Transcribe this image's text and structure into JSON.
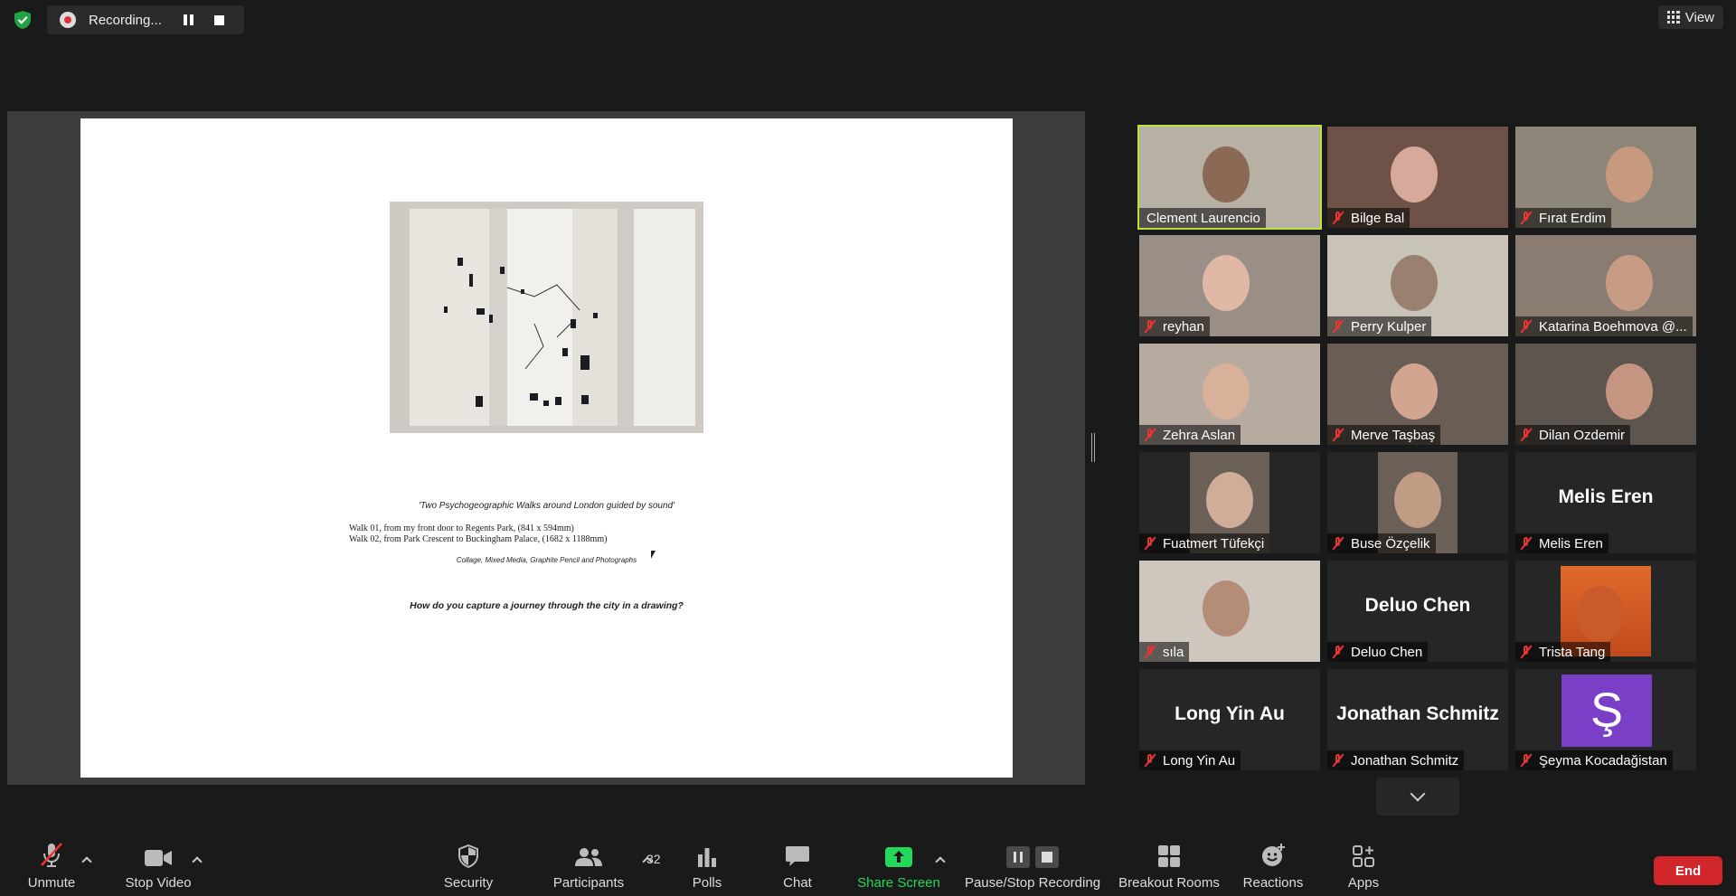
{
  "top_bar": {
    "recording_label": "Recording...",
    "view_label": "View"
  },
  "shared_slide": {
    "caption": "'Two Psychogeographic Walks around London guided by sound'",
    "walk_1": "Walk 01, from my front door to Regents Park, (841 x 594mm)",
    "walk_2": "Walk 02, from Park Crescent to Buckingham Palace, (1682 x 1188mm)",
    "medium": "Collage, Mixed Media, Graphite Pencil and Photographs",
    "question": "How do you capture a journey through the city in a drawing?"
  },
  "participants": [
    {
      "name": "Clement Laurencio",
      "muted": false,
      "active_speaker": true,
      "video": true
    },
    {
      "name": "Bilge Bal",
      "muted": true,
      "video": true
    },
    {
      "name": "Fırat Erdim",
      "muted": true,
      "video": true
    },
    {
      "name": "reyhan",
      "muted": true,
      "video": true
    },
    {
      "name": "Perry Kulper",
      "muted": true,
      "video": true
    },
    {
      "name": "Katarina Boehmova @...",
      "muted": true,
      "video": true
    },
    {
      "name": "Zehra Aslan",
      "muted": true,
      "video": true
    },
    {
      "name": "Merve Taşbaş",
      "muted": true,
      "video": true
    },
    {
      "name": "Dilan Ozdemir",
      "muted": true,
      "video": true
    },
    {
      "name": "Fuatmert Tüfekçi",
      "muted": true,
      "video": true
    },
    {
      "name": "Buse Özçelik",
      "muted": true,
      "video": true
    },
    {
      "name": "Melis Eren",
      "muted": true,
      "video": false,
      "big_name": "Melis Eren"
    },
    {
      "name": "sıla",
      "muted": true,
      "video": true
    },
    {
      "name": "Deluo Chen",
      "muted": true,
      "video": false,
      "big_name": "Deluo Chen"
    },
    {
      "name": "Trista Tang",
      "muted": true,
      "video": true
    },
    {
      "name": "Long Yin Au",
      "muted": true,
      "video": false,
      "big_name": "Long Yin Au"
    },
    {
      "name": "Jonathan Schmitz",
      "muted": true,
      "video": false,
      "big_name": "Jonathan Schmitz"
    },
    {
      "name": "Şeyma Kocadağistan",
      "muted": true,
      "video": false,
      "avatar_letter": "Ş",
      "avatar_color": "#7a3fc7"
    }
  ],
  "toolbar": {
    "unmute": "Unmute",
    "stop_video": "Stop Video",
    "security": "Security",
    "participants": "Participants",
    "participant_count": "32",
    "polls": "Polls",
    "chat": "Chat",
    "share_screen": "Share Screen",
    "pause_stop_recording": "Pause/Stop Recording",
    "breakout_rooms": "Breakout Rooms",
    "reactions": "Reactions",
    "apps": "Apps",
    "end": "End"
  },
  "colors": {
    "accent_green": "#23d959",
    "active_speaker": "#b8e23a",
    "end_red": "#d1262a",
    "mute_red": "#e33333"
  }
}
